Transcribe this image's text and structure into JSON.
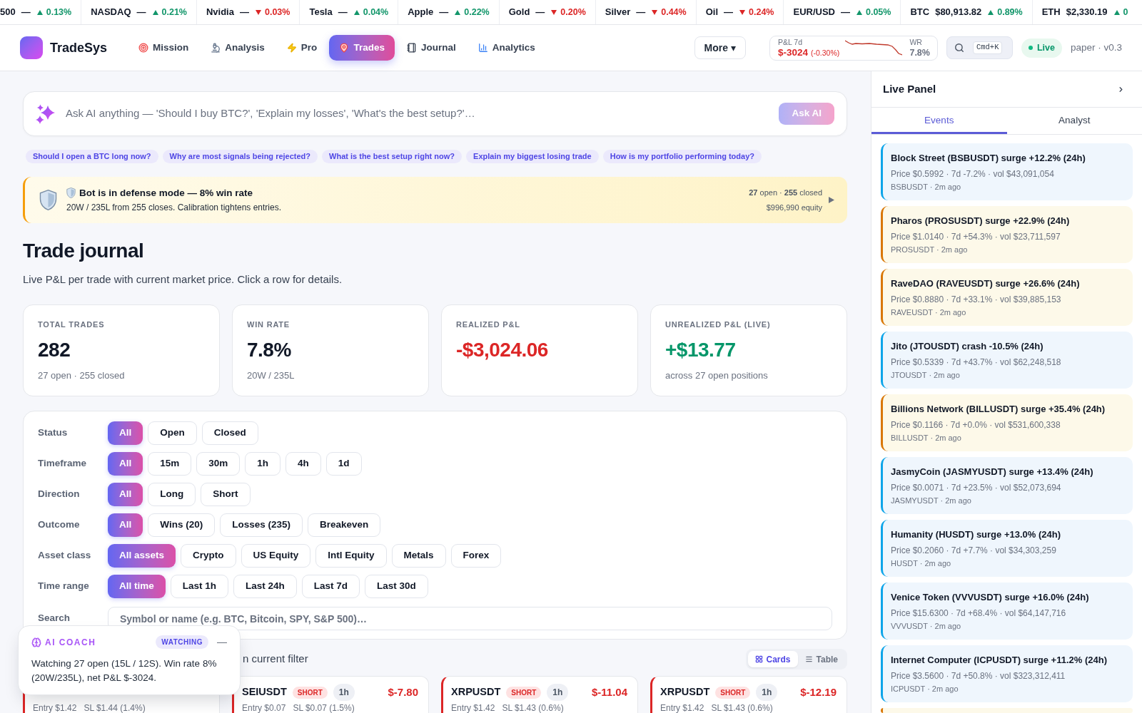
{
  "ticker": [
    {
      "symbol": "500",
      "price": "—",
      "change": "0.13%",
      "rising": true
    },
    {
      "symbol": "NASDAQ",
      "price": "—",
      "change": "0.21%",
      "rising": true
    },
    {
      "symbol": "Nvidia",
      "price": "—",
      "change": "0.03%",
      "rising": false
    },
    {
      "symbol": "Tesla",
      "price": "—",
      "change": "0.04%",
      "rising": true
    },
    {
      "symbol": "Apple",
      "price": "—",
      "change": "0.22%",
      "rising": true
    },
    {
      "symbol": "Gold",
      "price": "—",
      "change": "0.20%",
      "rising": false
    },
    {
      "symbol": "Silver",
      "price": "—",
      "change": "0.44%",
      "rising": false
    },
    {
      "symbol": "Oil",
      "price": "—",
      "change": "0.24%",
      "rising": false
    },
    {
      "symbol": "EUR/USD",
      "price": "—",
      "change": "0.05%",
      "rising": true
    },
    {
      "symbol": "BTC",
      "price": "$80,913.82",
      "change": "0.89%",
      "rising": true
    },
    {
      "symbol": "ETH",
      "price": "$2,330.19",
      "change": "0",
      "rising": true
    }
  ],
  "header": {
    "brand": "TradeSys",
    "nav": [
      {
        "label": "Mission",
        "selected": false
      },
      {
        "label": "Analysis",
        "selected": false
      },
      {
        "label": "Pro",
        "selected": false
      },
      {
        "label": "Trades",
        "selected": true
      },
      {
        "label": "Journal",
        "selected": false
      },
      {
        "label": "Analytics",
        "selected": false
      }
    ],
    "more": "More ▾",
    "pnl_widget": {
      "label": "P&L 7d",
      "value": "$-3024",
      "change": "(-0.30%)",
      "wr_label": "WR",
      "wr_value": "7.8%"
    },
    "search_shortcut": "Cmd+K",
    "status": "Live",
    "version": "paper · v0.3"
  },
  "ask_ai": {
    "placeholder": "Ask AI anything — 'Should I buy BTC?', 'Explain my losses', 'What's the best setup?'…",
    "button": "Ask AI",
    "button_disabled": true,
    "suggestions": [
      "Should I open a BTC long now?",
      "Why are most signals being rejected?",
      "What is the best setup right now?",
      "Explain my biggest losing trade",
      "How is my portfolio performing today?"
    ]
  },
  "alert": {
    "title": "Bot is in defense mode — 8% win rate",
    "message": "20W / 235L from 255 closes. Calibration tightens entries.",
    "counts": "**27** open · **255** closed",
    "equity": "$996,990 equity"
  },
  "page": {
    "title": "Trade journal",
    "subtitle": "Live P&L per trade with current market price. Click a row for details."
  },
  "stats": [
    {
      "label": "TOTAL TRADES",
      "value": "282",
      "color": "#111827",
      "note": "27 open · 255 closed"
    },
    {
      "label": "WIN RATE",
      "value": "7.8%",
      "color": "#111827",
      "note": "20W / 235L"
    },
    {
      "label": "REALIZED P&L",
      "value": "-$3,024.06",
      "color": "#dc2626"
    },
    {
      "label": "UNREALIZED P&L (LIVE)",
      "value": "+$13.77",
      "color": "#059669",
      "note": "across 27 open positions"
    }
  ],
  "filters": [
    {
      "label": "Status",
      "options": [
        {
          "label": "All",
          "selected": true
        },
        {
          "label": "Open",
          "selected": false
        },
        {
          "label": "Closed",
          "selected": false
        }
      ]
    },
    {
      "label": "Timeframe",
      "options": [
        {
          "label": "All",
          "selected": true
        },
        {
          "label": "15m",
          "selected": false
        },
        {
          "label": "30m",
          "selected": false
        },
        {
          "label": "1h",
          "selected": false
        },
        {
          "label": "4h",
          "selected": false
        },
        {
          "label": "1d",
          "selected": false
        }
      ]
    },
    {
      "label": "Direction",
      "options": [
        {
          "label": "All",
          "selected": true
        },
        {
          "label": "Long",
          "selected": false
        },
        {
          "label": "Short",
          "selected": false
        }
      ]
    },
    {
      "label": "Outcome",
      "options": [
        {
          "label": "All",
          "selected": true
        },
        {
          "label": "Wins (20)",
          "selected": false
        },
        {
          "label": "Losses (235)",
          "selected": false
        },
        {
          "label": "Breakeven",
          "selected": false
        }
      ]
    },
    {
      "label": "Asset class",
      "options": [
        {
          "label": "All assets",
          "selected": true
        },
        {
          "label": "Crypto",
          "selected": false
        },
        {
          "label": "US Equity",
          "selected": false
        },
        {
          "label": "Intl Equity",
          "selected": false
        },
        {
          "label": "Metals",
          "selected": false
        },
        {
          "label": "Forex",
          "selected": false
        }
      ]
    },
    {
      "label": "Time range",
      "options": [
        {
          "label": "All time",
          "selected": true
        },
        {
          "label": "Last 1h",
          "selected": false
        },
        {
          "label": "Last 24h",
          "selected": false
        },
        {
          "label": "Last 7d",
          "selected": false
        },
        {
          "label": "Last 30d",
          "selected": false
        }
      ]
    }
  ],
  "search": {
    "label": "Search",
    "placeholder": "Symbol or name (e.g. BTC, Bitcoin, SPY, S&P 500)…"
  },
  "results": {
    "summary": "n current filter",
    "views": [
      {
        "label": "Cards",
        "selected": true
      },
      {
        "label": "Table",
        "selected": false
      }
    ]
  },
  "trades": [
    {
      "loss": true,
      "entry": "Entry $1.42",
      "stop": "SL $1.44 (1.4%)"
    },
    {
      "symbol": "SEIUSDT",
      "side": "SHORT",
      "short": true,
      "timeframe": "1h",
      "pnl": "$-7.80",
      "loss": true,
      "entry": "Entry $0.07",
      "stop": "SL $0.07 (1.5%)"
    },
    {
      "symbol": "XRPUSDT",
      "side": "SHORT",
      "short": true,
      "timeframe": "1h",
      "pnl": "$-11.04",
      "loss": true,
      "entry": "Entry $1.42",
      "stop": "SL $1.43 (0.6%)"
    },
    {
      "symbol": "XRPUSDT",
      "side": "SHORT",
      "short": true,
      "timeframe": "1h",
      "pnl": "$-12.19",
      "loss": true,
      "entry": "Entry $1.42",
      "stop": "SL $1.43 (0.6%)"
    }
  ],
  "ai_coach": {
    "title": "AI COACH",
    "badge": "WATCHING",
    "minimize": "—",
    "message": "Watching 27 open (15L / 12S). Win rate 8% (20W/235L), net P&L $-3024."
  },
  "live_panel": {
    "title": "Live Panel",
    "tabs": [
      {
        "label": "Events",
        "selected": true
      },
      {
        "label": "Analyst",
        "selected": false
      }
    ],
    "events": [
      {
        "title": "Block Street (BSBUSDT) surge +12.2% (24h)",
        "detail": "Price $0.5992 · 7d -7.2% · vol $43,091,054",
        "meta": "BSBUSDT · 2m ago",
        "kind": "info"
      },
      {
        "title": "Pharos (PROSUSDT) surge +22.9% (24h)",
        "detail": "Price $1.0140 · 7d +54.3% · vol $23,711,597",
        "meta": "PROSUSDT · 2m ago",
        "kind": "warning"
      },
      {
        "title": "RaveDAO (RAVEUSDT) surge +26.6% (24h)",
        "detail": "Price $0.8880 · 7d +33.1% · vol $39,885,153",
        "meta": "RAVEUSDT · 2m ago",
        "kind": "warning"
      },
      {
        "title": "Jito (JTOUSDT) crash -10.5% (24h)",
        "detail": "Price $0.5339 · 7d +43.7% · vol $62,248,518",
        "meta": "JTOUSDT · 2m ago",
        "kind": "info"
      },
      {
        "title": "Billions Network (BILLUSDT) surge +35.4% (24h)",
        "detail": "Price $0.1166 · 7d +0.0% · vol $531,600,338",
        "meta": "BILLUSDT · 2m ago",
        "kind": "warning"
      },
      {
        "title": "JasmyCoin (JASMYUSDT) surge +13.4% (24h)",
        "detail": "Price $0.0071 · 7d +23.5% · vol $52,073,694",
        "meta": "JASMYUSDT · 2m ago",
        "kind": "info"
      },
      {
        "title": "Humanity (HUSDT) surge +13.0% (24h)",
        "detail": "Price $0.2060 · 7d +7.7% · vol $34,303,259",
        "meta": "HUSDT · 2m ago",
        "kind": "info"
      },
      {
        "title": "Venice Token (VVVUSDT) surge +16.0% (24h)",
        "detail": "Price $15.6300 · 7d +68.4% · vol $64,147,716",
        "meta": "VVVUSDT · 2m ago",
        "kind": "info"
      },
      {
        "title": "Internet Computer (ICPUSDT) surge +11.2% (24h)",
        "detail": "Price $3.5600 · 7d +50.8% · vol $323,312,411",
        "meta": "ICPUSDT · 2m ago",
        "kind": "info"
      },
      {
        "kind": "warning"
      }
    ]
  }
}
